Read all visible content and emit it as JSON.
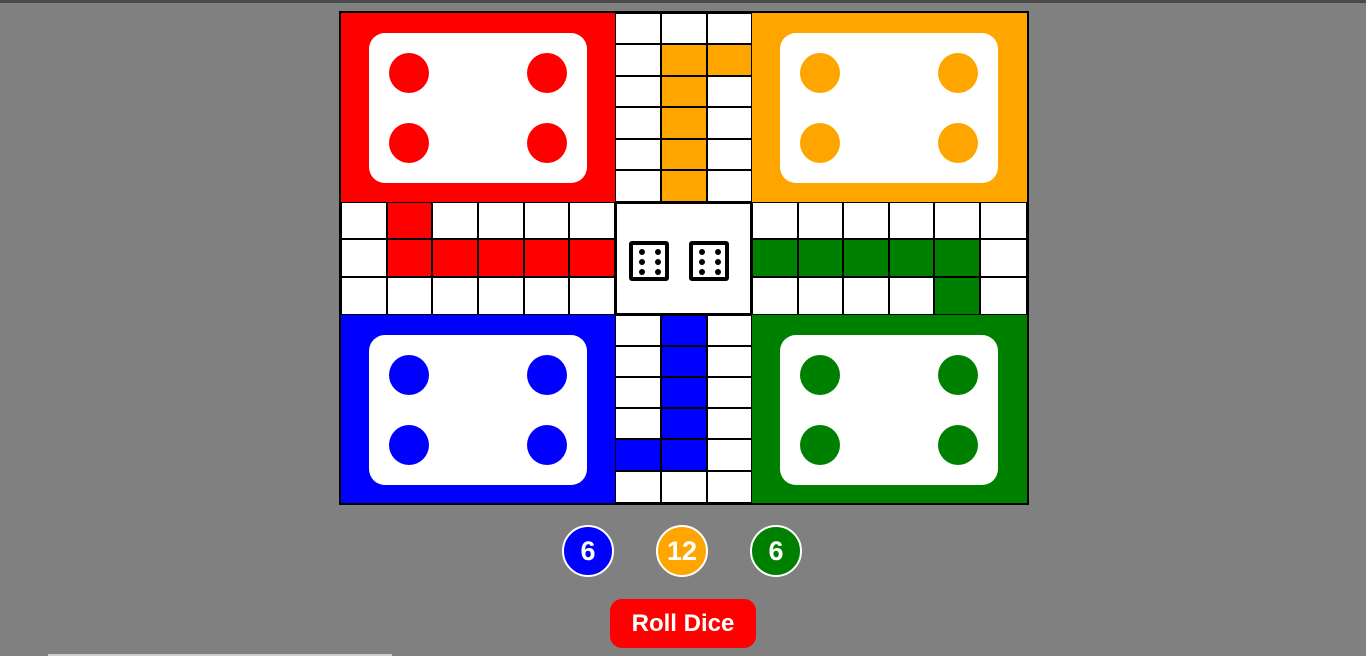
{
  "game": "Ludo",
  "colors": {
    "red": "#ff0000",
    "yellow": "#ffa500",
    "blue": "#0000ff",
    "green": "#008000",
    "background": "#808080"
  },
  "yards": [
    {
      "color": "red",
      "tokens_at_home": 4
    },
    {
      "color": "yellow",
      "tokens_at_home": 4
    },
    {
      "color": "blue",
      "tokens_at_home": 4
    },
    {
      "color": "green",
      "tokens_at_home": 4
    }
  ],
  "dice": {
    "faces": [
      6,
      6
    ],
    "icon": "die-six-icon"
  },
  "scores": [
    {
      "color": "blue",
      "value": "6"
    },
    {
      "color": "yellow",
      "value": "12"
    },
    {
      "color": "green",
      "value": "6"
    }
  ],
  "roll_button": {
    "label": "Roll Dice"
  }
}
